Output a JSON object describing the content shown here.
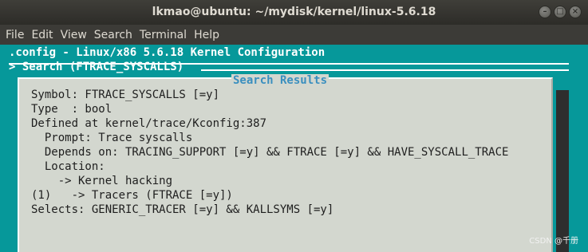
{
  "window": {
    "title": "lkmao@ubuntu: ~/mydisk/kernel/linux-5.6.18",
    "controls": {
      "minimize": "–",
      "maximize": "□",
      "close": "×"
    }
  },
  "menubar": [
    "File",
    "Edit",
    "View",
    "Search",
    "Terminal",
    "Help"
  ],
  "terminal": {
    "header_line": ".config - Linux/x86 5.6.18 Kernel Configuration",
    "breadcrumb_line": "> Search (FTRACE_SYSCALLS)",
    "colors": {
      "background": "#06989a",
      "dialog": "#d3d7cf",
      "dialog_title": "#3a8fbf"
    }
  },
  "dialog": {
    "title": "Search Results",
    "lines": [
      "Symbol: FTRACE_SYSCALLS [=y]",
      "Type  : bool",
      "Defined at kernel/trace/Kconfig:387",
      "  Prompt: Trace syscalls",
      "  Depends on: TRACING_SUPPORT [=y] && FTRACE [=y] && HAVE_SYSCALL_TRACE",
      "  Location:",
      "    -> Kernel hacking",
      "(1)   -> Tracers (FTRACE [=y])",
      "Selects: GENERIC_TRACER [=y] && KALLSYMS [=y]"
    ]
  },
  "watermark": "CSDN @千册"
}
